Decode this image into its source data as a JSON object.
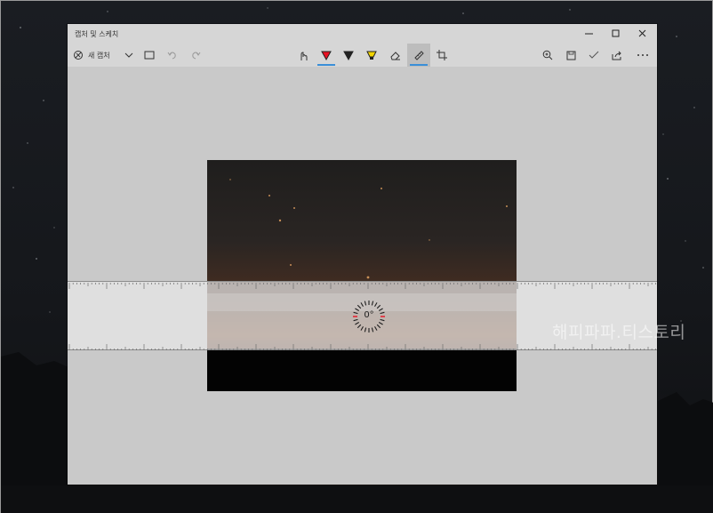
{
  "window": {
    "title": "캡처 및 스케치",
    "minimize_icon": "minimize-icon",
    "maximize_icon": "maximize-icon",
    "close_icon": "close-icon"
  },
  "toolbar": {
    "new_capture_label": "새 캡처",
    "tools": [
      {
        "name": "touch-writing-icon"
      },
      {
        "name": "ballpoint-pen-icon",
        "color": "#e81123",
        "active": true
      },
      {
        "name": "pencil-icon",
        "color": "#222222"
      },
      {
        "name": "highlighter-icon",
        "color": "#f2d400"
      },
      {
        "name": "eraser-icon"
      },
      {
        "name": "ruler-icon",
        "active": true
      },
      {
        "name": "crop-icon"
      }
    ],
    "right_icons": [
      "zoom-in-icon",
      "save-icon",
      "copy-check-icon",
      "share-icon",
      "more-icon"
    ]
  },
  "ruler": {
    "angle": "0°"
  },
  "watermark": "해피파파.티스토리",
  "colors": {
    "accent": "#3a8fd8",
    "pen_red": "#e81123",
    "highlighter_yellow": "#f2d400"
  }
}
